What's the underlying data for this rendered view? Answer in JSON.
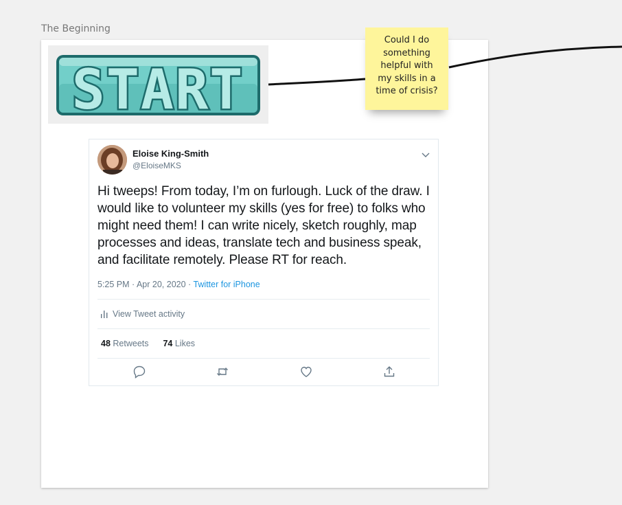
{
  "frame": {
    "label": "The Beginning"
  },
  "start_graphic": {
    "text": "START",
    "fill": "#72cfc9",
    "dark": "#1d6b6b",
    "light": "#b6ebe6"
  },
  "sticky_note": {
    "lines": [
      "Could I do",
      "something",
      "helpful with",
      "my skills in a",
      "time of crisis?"
    ],
    "color": "#fef59b"
  },
  "tweet": {
    "author": {
      "name": "Eloise King-Smith",
      "handle": "@EloiseMKS"
    },
    "text": "Hi tweeps! From today, I’m on furlough. Luck of the draw. I would like to volunteer my skills (yes for free) to folks who might need them! I can write nicely, sketch roughly, map processes and ideas, translate tech and business speak, and facilitate remotely. Please RT for reach.",
    "time": "5:25 PM · Apr 20, 2020 · ",
    "source": "Twitter for iPhone",
    "activity_label": "View Tweet activity",
    "retweets": {
      "count": "48",
      "label": "Retweets"
    },
    "likes": {
      "count": "74",
      "label": "Likes"
    },
    "actions": [
      "reply-icon",
      "retweet-icon",
      "like-icon",
      "share-icon"
    ],
    "colors": {
      "link": "#1b95e0",
      "muted": "#657786",
      "text": "#14171a"
    }
  }
}
